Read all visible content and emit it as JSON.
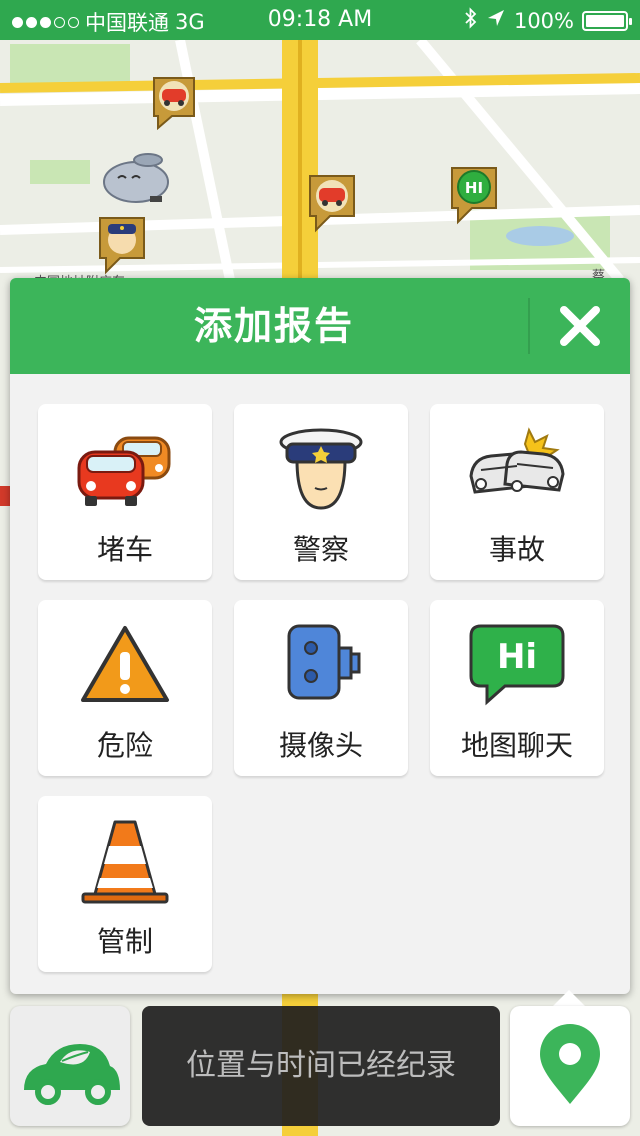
{
  "status_bar": {
    "carrier": "中国联通",
    "network": "3G",
    "time": "09:18 AM",
    "battery": "100%",
    "signal_bars_filled": 3,
    "signal_bars_total": 5
  },
  "map": {
    "road_color": "#f5cf3a",
    "park_color": "#bfe3a8",
    "water_color": "#9fc6e6"
  },
  "dialog": {
    "title": "添加报告",
    "close_icon": "close-icon",
    "accent": "#3cb55a",
    "options": [
      {
        "label": "堵车",
        "icon": "traffic-jam-icon"
      },
      {
        "label": "警察",
        "icon": "police-icon"
      },
      {
        "label": "事故",
        "icon": "accident-icon"
      },
      {
        "label": "危险",
        "icon": "hazard-icon"
      },
      {
        "label": "摄像头",
        "icon": "speed-camera-icon"
      },
      {
        "label": "地图聊天",
        "icon": "map-chat-icon"
      },
      {
        "label": "管制",
        "icon": "traffic-cone-icon"
      }
    ]
  },
  "bottom_bar": {
    "toast_text": "位置与时间已经纪录",
    "car_icon": "eco-car-icon",
    "report_icon": "location-pin-icon"
  }
}
